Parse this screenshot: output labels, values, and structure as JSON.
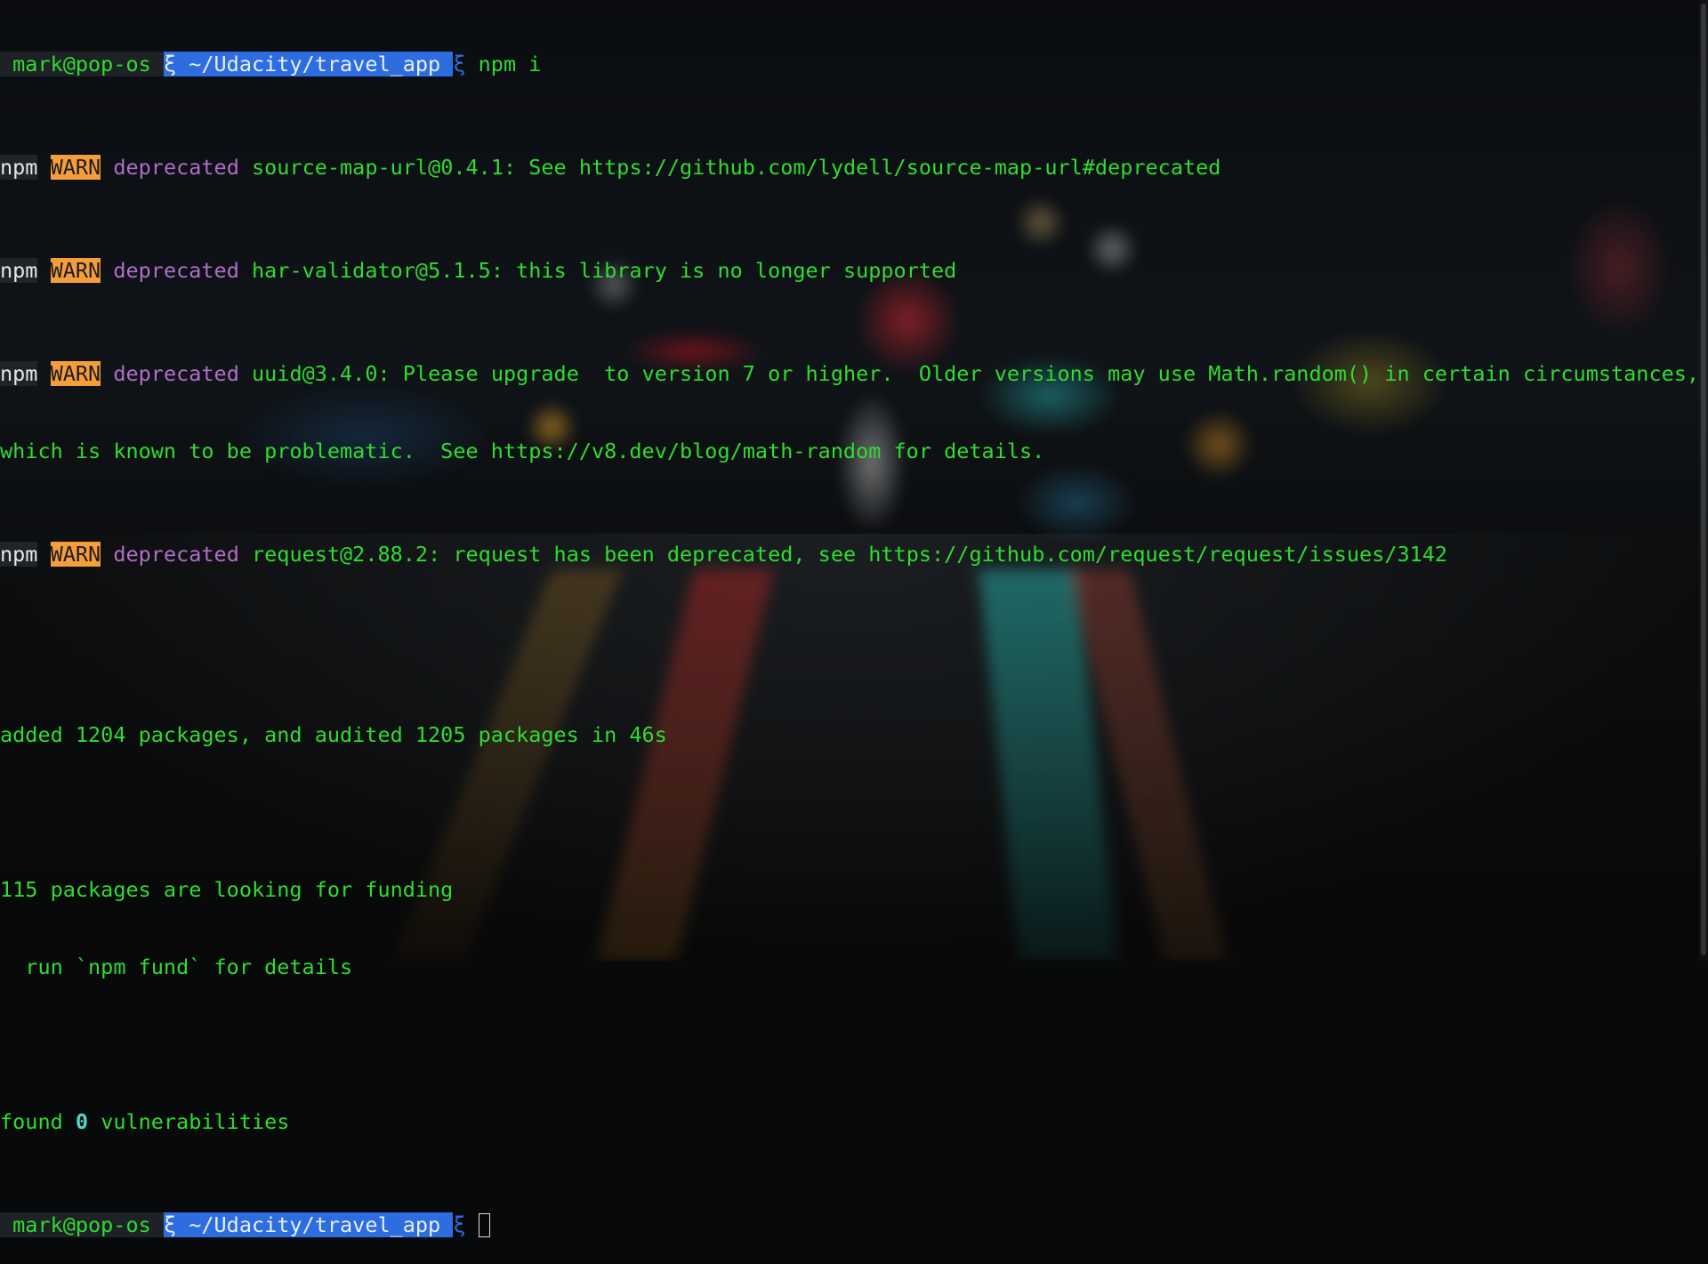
{
  "colors": {
    "prompt_green": "#2fdc2f",
    "path_blue": "#2d6de0",
    "warn_orange": "#f59d3a",
    "deprecated_purple": "#b06ec8",
    "vuln_count_cyan": "#4fd8c6"
  },
  "prompt1": {
    "user_host": " mark@pop-os ",
    "sep_icon": "ξ",
    "path": " ~/Udacity/travel_app ",
    "end_icon": "ξ",
    "command": " npm i"
  },
  "warnings": [
    {
      "npm": "npm",
      "level": "WARN",
      "tag": "deprecated",
      "message": "source-map-url@0.4.1: See https://github.com/lydell/source-map-url#deprecated"
    },
    {
      "npm": "npm",
      "level": "WARN",
      "tag": "deprecated",
      "message": "har-validator@5.1.5: this library is no longer supported"
    },
    {
      "npm": "npm",
      "level": "WARN",
      "tag": "deprecated",
      "message": "uuid@3.4.0: Please upgrade  to version 7 or higher.  Older versions may use Math.random() in certain circumstances,",
      "continuation": "which is known to be problematic.  See https://v8.dev/blog/math-random for details."
    },
    {
      "npm": "npm",
      "level": "WARN",
      "tag": "deprecated",
      "message": "request@2.88.2: request has been deprecated, see https://github.com/request/request/issues/3142"
    }
  ],
  "summary": {
    "added": "added 1204 packages, and audited 1205 packages in 46s",
    "funding": "115 packages are looking for funding",
    "funding_hint": "  run `npm fund` for details",
    "found_prefix": "found ",
    "vuln_count": "0",
    "found_suffix": " vulnerabilities"
  },
  "prompt2": {
    "user_host": " mark@pop-os ",
    "sep_icon": "ξ",
    "path": " ~/Udacity/travel_app ",
    "end_icon": "ξ"
  }
}
